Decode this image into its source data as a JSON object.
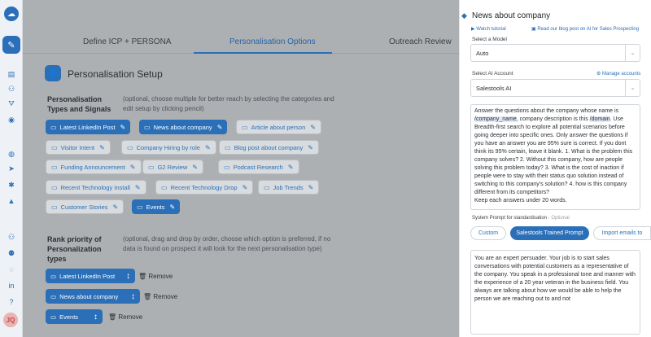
{
  "tabs": [
    "Define ICP + PERSONA",
    "Personalisation Options",
    "Outreach Review"
  ],
  "setup": {
    "title": "Personalisation Setup",
    "types_label": "Personalisation Types and Signals",
    "types_hint": "(optional, choose multiple for better reach by selecting the categories and edit setup by clicking pencil)",
    "rank_label": "Rank priority of Personalization types",
    "rank_hint": "(optional, drag and drop by order, choose which option is preferred, if no data is found on prospect it will look for the next personalisation type)"
  },
  "chips": [
    {
      "label": "Latest LinkedIn Post",
      "selected": true
    },
    {
      "label": "News about company",
      "selected": true
    },
    {
      "label": "Article about person",
      "selected": false
    },
    {
      "label": "Visitor Intent",
      "selected": false
    },
    {
      "label": "Company Hiring by role",
      "selected": false
    },
    {
      "label": "Blog post about company",
      "selected": false
    },
    {
      "label": "Funding Announcement",
      "selected": false
    },
    {
      "label": "G2 Review",
      "selected": false
    },
    {
      "label": "Podcast Research",
      "selected": false
    },
    {
      "label": "Recent Technology Install",
      "selected": false
    },
    {
      "label": "Recent Technology Drop",
      "selected": false
    },
    {
      "label": "Job Trends",
      "selected": false
    },
    {
      "label": "Customer Stories",
      "selected": false
    },
    {
      "label": "Events",
      "selected": true
    }
  ],
  "rank_items": [
    {
      "label": "Latest LinkedIn Post",
      "remove": "Remove"
    },
    {
      "label": "News about company",
      "remove": "Remove"
    },
    {
      "label": "Events",
      "remove": "Remove"
    }
  ],
  "panel": {
    "title": "News about company",
    "watch_tutorial": "Watch tutorial",
    "blog_link": "Read our blog post on AI for Sales Prospecting",
    "model_label": "Select a Model",
    "model_value": "Auto",
    "account_label": "Select AI Account",
    "manage_accounts": "Manage accounts",
    "account_value": "Salestools AI",
    "prompt_pre": "Answer the questions about the company whose name is ",
    "prompt_company_tag": "/company_name",
    "prompt_mid": ", company description is this ",
    "prompt_domain_tag": "/domain",
    "prompt_post": ". Use Breadth-first search to explore all potential scenarios before going deeper into specific ones. Only answer the questions if you have an answer you are 95% sure is correct. If you dont think its 95% certain, leave it blank. 1. What is the problem this company solves? 2. Without this company, how are people solving this problem today? 3. What is the cost of inaction if people were to stay with their status quo solution instead of switching to this company's solution? 4. how is this company different from its competitors?",
    "prompt_last": "Keep each answers under 20 words.",
    "system_prompt_label": "System Prompt for standardisation",
    "system_prompt_optional": "Optional",
    "mode_options": [
      "Custom",
      "Salestools Trained Prompt",
      "Import emails to"
    ],
    "mode_selected": "Salestools Trained Prompt",
    "system_prompt_text": "You are an expert persuader. Your job is to start sales conversations with potential customers as a representative of the company. You speak in a professional tone and manner with the experience of a 20 year veteran in the business field. You always are talking about how we would be able to help the person we are reaching out to and not"
  },
  "user_initials": "JQ"
}
